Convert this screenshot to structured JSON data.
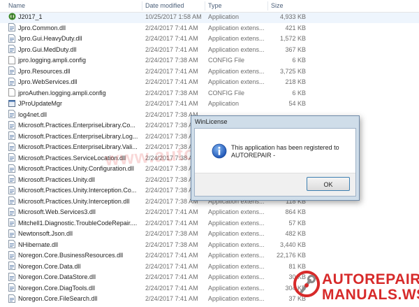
{
  "columns": {
    "name": "Name",
    "date": "Date modified",
    "type": "Type",
    "size": "Size"
  },
  "files": [
    {
      "name": "J2017_1",
      "date": "10/25/2017 1:58 AM",
      "type": "Application",
      "size": "4,933 KB",
      "icon": "app-icon",
      "selected": true
    },
    {
      "name": "Jpro.Common.dll",
      "date": "2/24/2017 7:41 AM",
      "type": "Application extens...",
      "size": "421 KB",
      "icon": "dll-icon"
    },
    {
      "name": "Jpro.Gui.HeavyDuty.dll",
      "date": "2/24/2017 7:41 AM",
      "type": "Application extens...",
      "size": "1,572 KB",
      "icon": "dll-icon"
    },
    {
      "name": "Jpro.Gui.MedDuty.dll",
      "date": "2/24/2017 7:41 AM",
      "type": "Application extens...",
      "size": "367 KB",
      "icon": "dll-icon"
    },
    {
      "name": "jpro.logging.ampli.config",
      "date": "2/24/2017 7:38 AM",
      "type": "CONFIG File",
      "size": "6 KB",
      "icon": "file-icon"
    },
    {
      "name": "Jpro.Resources.dll",
      "date": "2/24/2017 7:41 AM",
      "type": "Application extens...",
      "size": "3,725 KB",
      "icon": "dll-icon"
    },
    {
      "name": "Jpro.WebServices.dll",
      "date": "2/24/2017 7:41 AM",
      "type": "Application extens...",
      "size": "218 KB",
      "icon": "dll-icon"
    },
    {
      "name": "jproAuthen.logging.ampli.config",
      "date": "2/24/2017 7:38 AM",
      "type": "CONFIG File",
      "size": "6 KB",
      "icon": "file-icon"
    },
    {
      "name": "JProUpdateMgr",
      "date": "2/24/2017 7:41 AM",
      "type": "Application",
      "size": "54 KB",
      "icon": "exe-icon"
    },
    {
      "name": "log4net.dll",
      "date": "2/24/2017 7:38 AM",
      "type": "",
      "size": "",
      "icon": "dll-icon"
    },
    {
      "name": "Microsoft.Practices.EnterpriseLibrary.Co...",
      "date": "2/24/2017 7:38 AM",
      "type": "",
      "size": "",
      "icon": "dll-icon"
    },
    {
      "name": "Microsoft.Practices.EnterpriseLibrary.Log...",
      "date": "2/24/2017 7:38 AM",
      "type": "",
      "size": "",
      "icon": "dll-icon"
    },
    {
      "name": "Microsoft.Practices.EnterpriseLibrary.Vali...",
      "date": "2/24/2017 7:38 AM",
      "type": "",
      "size": "",
      "icon": "dll-icon"
    },
    {
      "name": "Microsoft.Practices.ServiceLocation.dll",
      "date": "2/24/2017 7:38 AM",
      "type": "",
      "size": "",
      "icon": "dll-icon"
    },
    {
      "name": "Microsoft.Practices.Unity.Configuration.dll",
      "date": "2/24/2017 7:38 AM",
      "type": "",
      "size": "",
      "icon": "dll-icon"
    },
    {
      "name": "Microsoft.Practices.Unity.dll",
      "date": "2/24/2017 7:38 AM",
      "type": "",
      "size": "",
      "icon": "dll-icon"
    },
    {
      "name": "Microsoft.Practices.Unity.Interception.Co...",
      "date": "2/24/2017 7:38 AM",
      "type": "",
      "size": "",
      "icon": "dll-icon"
    },
    {
      "name": "Microsoft.Practices.Unity.Interception.dll",
      "date": "2/24/2017 7:38 AM",
      "type": "Application extens...",
      "size": "118 KB",
      "icon": "dll-icon"
    },
    {
      "name": "Microsoft.Web.Services3.dll",
      "date": "2/24/2017 7:41 AM",
      "type": "Application extens...",
      "size": "864 KB",
      "icon": "dll-icon"
    },
    {
      "name": "Mitchell1.Diagnostic.TroubleCodeRepair....",
      "date": "2/24/2017 7:41 AM",
      "type": "Application extens...",
      "size": "57 KB",
      "icon": "dll-icon"
    },
    {
      "name": "Newtonsoft.Json.dll",
      "date": "2/24/2017 7:38 AM",
      "type": "Application extens...",
      "size": "482 KB",
      "icon": "dll-icon"
    },
    {
      "name": "NHibernate.dll",
      "date": "2/24/2017 7:38 AM",
      "type": "Application extens...",
      "size": "3,440 KB",
      "icon": "dll-icon"
    },
    {
      "name": "Noregon.Core.BusinessResources.dll",
      "date": "2/24/2017 7:41 AM",
      "type": "Application extens...",
      "size": "22,176 KB",
      "icon": "dll-icon"
    },
    {
      "name": "Noregon.Core.Data.dll",
      "date": "2/24/2017 7:41 AM",
      "type": "Application extens...",
      "size": "81 KB",
      "icon": "dll-icon"
    },
    {
      "name": "Noregon.Core.DataStore.dll",
      "date": "2/24/2017 7:41 AM",
      "type": "Application extens...",
      "size": "30 KB",
      "icon": "dll-icon"
    },
    {
      "name": "Noregon.Core.DiagTools.dll",
      "date": "2/24/2017 7:41 AM",
      "type": "Application extens...",
      "size": "304 KB",
      "icon": "dll-icon"
    },
    {
      "name": "Noregon.Core.FileSearch.dll",
      "date": "2/24/2017 7:41 AM",
      "type": "Application extens...",
      "size": "37 KB",
      "icon": "dll-icon"
    }
  ],
  "dialog": {
    "title": "WinLicense",
    "message_line1": "This application has been registered to",
    "message_line2": "AUTOREPAIR -",
    "ok_label": "OK",
    "icon": "info-icon"
  },
  "watermark": {
    "text": "www.autorepairmanuals.ws"
  },
  "logo": {
    "line1": "AUTOREPAIR",
    "line2": "MANUALS.WS"
  },
  "colors": {
    "header_text": "#4c607a",
    "selection": "#eef5fd",
    "dialog_frame": "#cfdde9",
    "brand_red": "#d72a2a"
  }
}
